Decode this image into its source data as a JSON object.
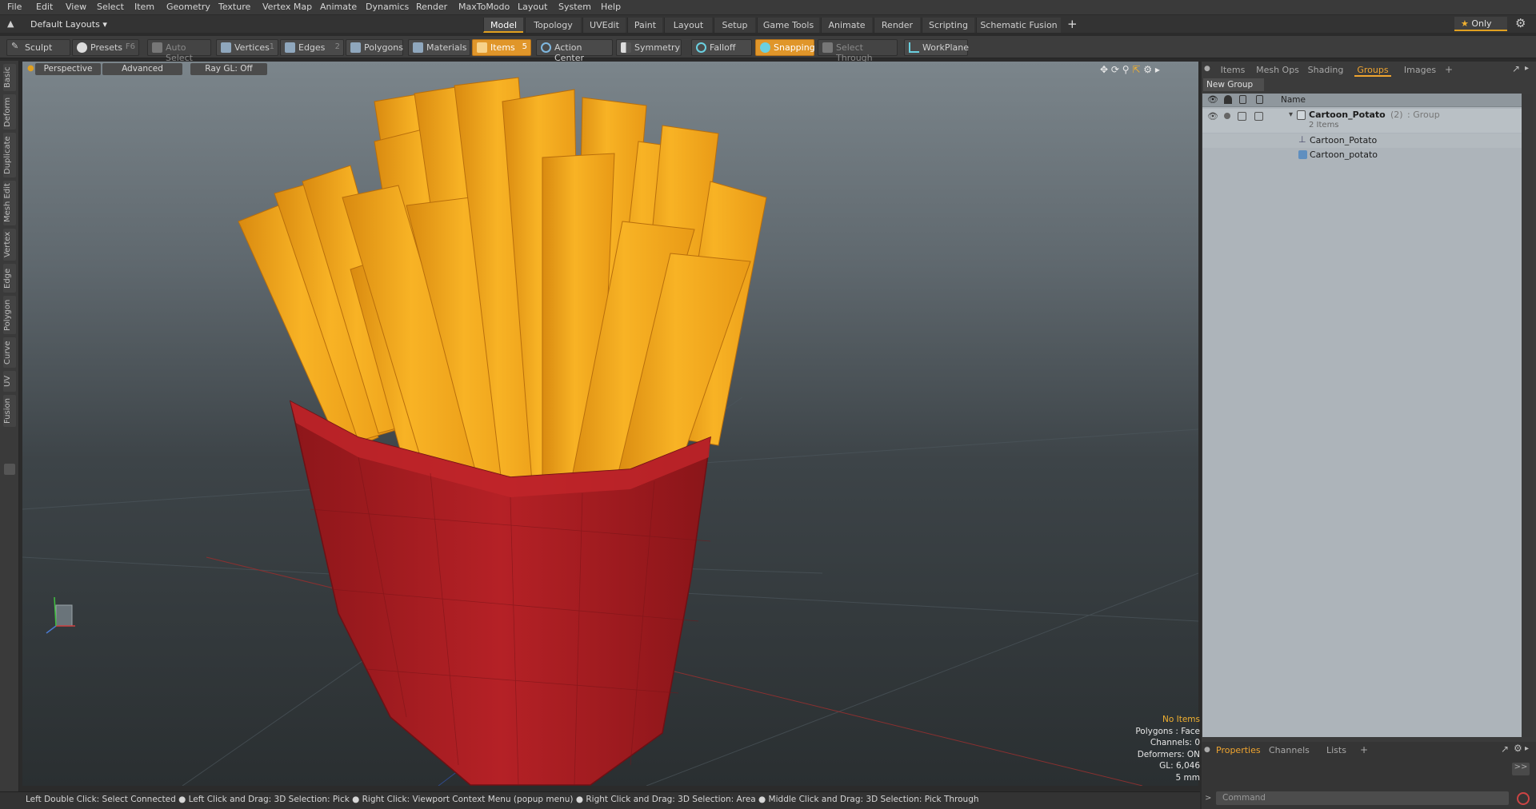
{
  "menu": [
    "File",
    "Edit",
    "View",
    "Select",
    "Item",
    "Geometry",
    "Texture",
    "Vertex Map",
    "Animate",
    "Dynamics",
    "Render",
    "MaxToModo",
    "Layout",
    "System",
    "Help"
  ],
  "layout_selector": "Default Layouts",
  "layout_tabs": [
    "Model",
    "Topology",
    "UVEdit",
    "Paint",
    "Layout",
    "Setup",
    "Game Tools",
    "Animate",
    "Render",
    "Scripting",
    "Schematic Fusion"
  ],
  "layout_tab_add": "+",
  "only_label": "Only",
  "toolbar": {
    "sculpt": "Sculpt",
    "presets": "Presets",
    "presets_key": "F6",
    "auto_select": "Auto Select",
    "vertices": "Vertices",
    "vertices_count": "1",
    "edges": "Edges",
    "edges_count": "2",
    "polygons": "Polygons",
    "materials": "Materials",
    "items": "Items",
    "items_count": "5",
    "action_center": "Action Center",
    "symmetry": "Symmetry",
    "falloff": "Falloff",
    "snapping": "Snapping",
    "select_through": "Select Through",
    "workplane": "WorkPlane"
  },
  "left_tabs": [
    "Basic",
    "Deform",
    "Duplicate",
    "Mesh Edit",
    "Vertex",
    "Edge",
    "Polygon",
    "Curve",
    "UV",
    "Fusion"
  ],
  "viewport": {
    "view_mode": "Perspective",
    "shading": "Advanced",
    "raygl": "Ray GL: Off",
    "stats": [
      "No Items",
      "Polygons : Face",
      "Channels: 0",
      "Deformers: ON",
      "GL: 6,046",
      "5 mm"
    ]
  },
  "status_text": "Left Double Click: Select Connected ● Left Click and Drag: 3D Selection: Pick ● Right Click: Viewport Context Menu (popup menu) ● Right Click and Drag: 3D Selection: Area ● Middle Click and Drag: 3D Selection: Pick Through",
  "right_tabs": [
    "Items",
    "Mesh Ops",
    "Shading",
    "Groups",
    "Images"
  ],
  "right_tab_add": "+",
  "active_right_tab": "Groups",
  "new_group": "New Group",
  "list_header": "Name",
  "group": {
    "name": "Cartoon_Potato",
    "count": "(2)",
    "type": ": Group",
    "subtitle": "2 Items"
  },
  "children": [
    {
      "name": "Cartoon_Potato",
      "icon": "locator-icon"
    },
    {
      "name": "Cartoon_potato",
      "icon": "mesh-icon"
    }
  ],
  "bottom_tabs": [
    "Properties",
    "Channels",
    "Lists"
  ],
  "bottom_tab_add": "+",
  "command_placeholder": "Command",
  "colors": {
    "accent": "#e0962a",
    "fries": "#f5ac1c",
    "box": "#a81e22"
  }
}
